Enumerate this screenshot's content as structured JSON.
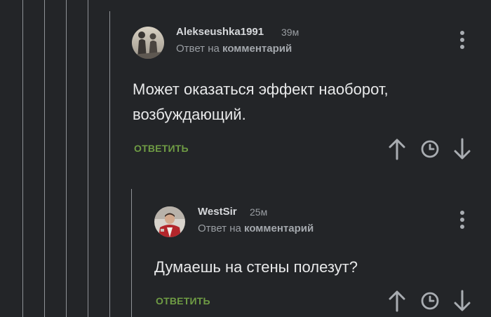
{
  "thread": {
    "comments": [
      {
        "author": "Alekseushka1991",
        "time": "39м",
        "reply_prefix": "Ответ на",
        "reply_target": "комментарий",
        "text_line1": "Может оказаться эффект наоборот,",
        "text_line2": "возбуждающий.",
        "reply_label": "ОТВЕТИТЬ",
        "icons": [
          "more-vertical-icon",
          "arrow-up-icon",
          "clock-icon",
          "arrow-down-icon"
        ]
      },
      {
        "author": "WestSir",
        "time": "25м",
        "reply_prefix": "Ответ на",
        "reply_target": "комментарий",
        "text_line1": "Думаешь на стены полезут?",
        "reply_label": "ОТВЕТИТЬ",
        "icons": [
          "more-vertical-icon",
          "arrow-up-icon",
          "clock-icon",
          "arrow-down-icon"
        ]
      }
    ]
  },
  "colors": {
    "background": "#232528",
    "thread_line": "#8f9297",
    "author": "#d6d8db",
    "meta": "#9a9ea3",
    "body_text": "#e8e9ea",
    "reply_green": "#6f9c44",
    "icon": "#a9adb2"
  }
}
